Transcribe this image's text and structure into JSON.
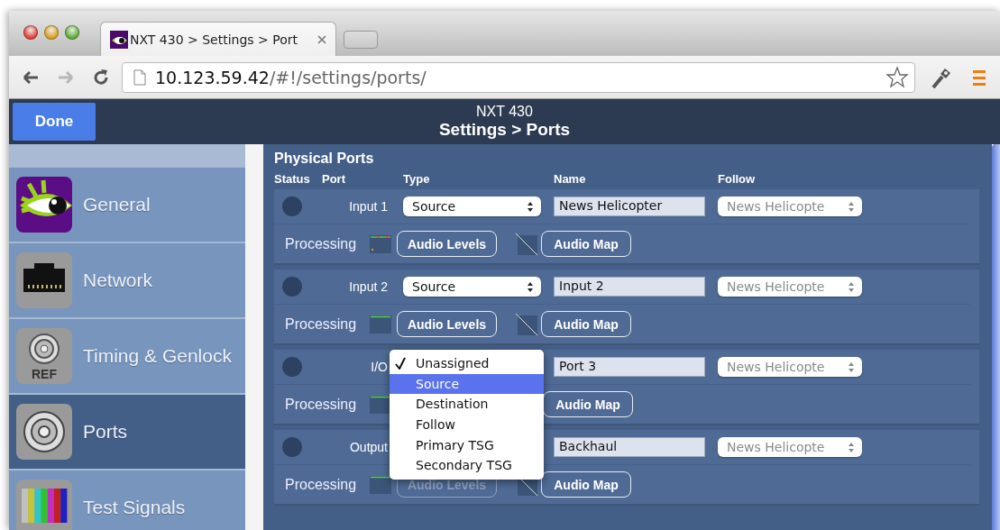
{
  "browser": {
    "tabs": [
      {
        "title": "NXT 430 > Settings > Port",
        "selected": true
      }
    ],
    "nav_buttons": [
      {
        "kind": "back",
        "disabled": false
      },
      {
        "kind": "forward",
        "disabled": true
      },
      {
        "kind": "reload",
        "disabled": false
      }
    ],
    "url": {
      "host": "10.123.59.42",
      "path": "/#!/settings/ports/"
    }
  },
  "header": {
    "done": "Done",
    "device": "NXT 430",
    "title": "Settings > Ports"
  },
  "sidebar": {
    "items": [
      {
        "label": "General",
        "kind": "eye",
        "selected": false
      },
      {
        "label": "Network",
        "kind": "network",
        "selected": false
      },
      {
        "label": "Timing & Genlock",
        "kind": "ref",
        "icon_text": "REF",
        "selected": false
      },
      {
        "label": "Ports",
        "kind": "connector",
        "selected": true
      },
      {
        "label": "Test Signals",
        "kind": "bars",
        "selected": false
      }
    ]
  },
  "ports": {
    "title": "Physical Ports",
    "columns": [
      "Status",
      "Port",
      "Type",
      "Name",
      "Follow"
    ],
    "rows": [
      {
        "port": "Input 1",
        "type": "Source",
        "name": "News Helicopter",
        "follow": "News Helicopte",
        "follow_disabled": true,
        "processing": "Processing",
        "meter_peaks": true,
        "audio_levels": "Audio Levels",
        "audio_levels_disabled": false,
        "audio_map": "Audio Map"
      },
      {
        "port": "Input 2",
        "type": "Source",
        "name": "Input 2",
        "follow": "News Helicopte",
        "follow_disabled": true,
        "processing": "Processing",
        "meter_peaks": false,
        "audio_levels": "Audio Levels",
        "audio_levels_disabled": false,
        "audio_map": "Audio Map"
      },
      {
        "port": "I/O",
        "name": "Port 3",
        "follow": "News Helicopte",
        "follow_disabled": true,
        "processing": "Processing",
        "meter_peaks": false,
        "audio_map": "Audio Map",
        "type_menu": {
          "items": [
            {
              "label": "Unassigned",
              "checked": true,
              "selected": false
            },
            {
              "label": "Source",
              "checked": false,
              "selected": true
            },
            {
              "label": "Destination",
              "checked": false,
              "selected": false
            },
            {
              "label": "Follow",
              "checked": false,
              "selected": false
            },
            {
              "label": "Primary TSG",
              "checked": false,
              "selected": false
            },
            {
              "label": "Secondary TSG",
              "checked": false,
              "selected": false
            }
          ]
        }
      },
      {
        "port": "Output",
        "name": "Backhaul",
        "follow": "News Helicopte",
        "follow_disabled": true,
        "processing": "Processing",
        "meter_peaks": false,
        "audio_levels": "Audio Levels",
        "audio_levels_disabled": true,
        "audio_map": "Audio Map"
      }
    ]
  }
}
